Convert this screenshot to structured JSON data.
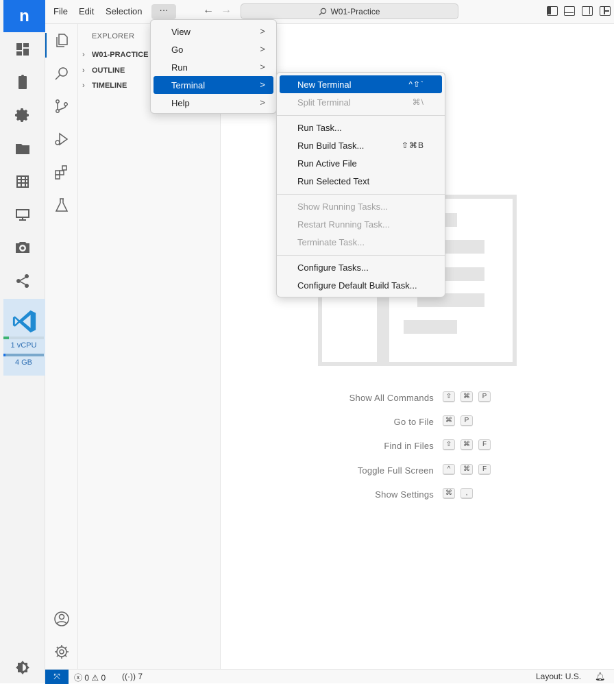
{
  "app_rail": {
    "logo": "n",
    "vscode_tile": {
      "cpu": "1 vCPU",
      "memory": "4 GB"
    }
  },
  "titlebar": {
    "menus": [
      "File",
      "Edit",
      "Selection"
    ],
    "more_label": "···",
    "back_icon": "←",
    "forward_icon": "→",
    "command_center": "W01-Practice"
  },
  "sidebar": {
    "title": "EXPLORER",
    "sections": [
      "W01-PRACTICE",
      "OUTLINE",
      "TIMELINE"
    ]
  },
  "main_menu": {
    "items": [
      {
        "label": "View",
        "arrow": ">"
      },
      {
        "label": "Go",
        "arrow": ">"
      },
      {
        "label": "Run",
        "arrow": ">"
      },
      {
        "label": "Terminal",
        "arrow": ">"
      },
      {
        "label": "Help",
        "arrow": ">"
      }
    ]
  },
  "terminal_menu": {
    "items": [
      {
        "label": "New Terminal",
        "shortcut": "^⇧`"
      },
      {
        "label": "Split Terminal",
        "shortcut": "⌘\\"
      },
      {
        "label": "Run Task..."
      },
      {
        "label": "Run Build Task...",
        "shortcut": "⇧⌘B"
      },
      {
        "label": "Run Active File"
      },
      {
        "label": "Run Selected Text"
      },
      {
        "label": "Show Running Tasks..."
      },
      {
        "label": "Restart Running Task..."
      },
      {
        "label": "Terminate Task..."
      },
      {
        "label": "Configure Tasks..."
      },
      {
        "label": "Configure Default Build Task..."
      }
    ]
  },
  "editor": {
    "shortcuts": [
      {
        "label": "Show All Commands",
        "keys": [
          "⇧",
          "⌘",
          "P"
        ]
      },
      {
        "label": "Go to File",
        "keys": [
          "⌘",
          "P"
        ]
      },
      {
        "label": "Find in Files",
        "keys": [
          "⇧",
          "⌘",
          "F"
        ]
      },
      {
        "label": "Toggle Full Screen",
        "keys": [
          "^",
          "⌘",
          "F"
        ]
      },
      {
        "label": "Show Settings",
        "keys": [
          "⌘",
          ","
        ]
      }
    ]
  },
  "statusbar": {
    "errors": "0",
    "warnings": "0",
    "ports": "7",
    "layout": "Layout: U.S."
  },
  "colors": {
    "accent": "#0060c0",
    "logo_blue": "#1a73e8",
    "status_remote": "#005fb8"
  }
}
